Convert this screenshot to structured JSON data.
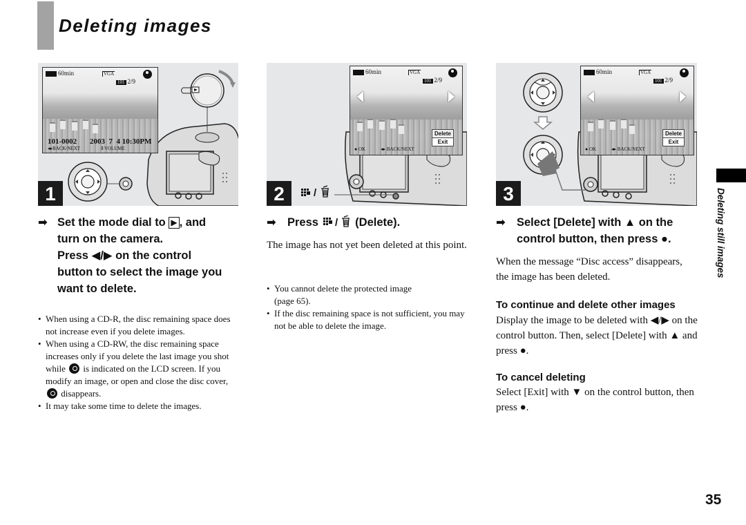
{
  "page": {
    "title": "Deleting images",
    "side_label": "Deleting still images",
    "page_number": "35"
  },
  "lcd": {
    "battery": "60min",
    "quality": "VGA",
    "folder": "101",
    "counter": "2/9",
    "file_number": "101-0002",
    "date_time": "2003  7  4 10:30PM",
    "back_next": "◂▸BACK/NEXT",
    "volume": "⇕VOLUME",
    "ok": "● OK",
    "back_next_2": "◂▸ BACK/NEXT",
    "delete_option": "Delete",
    "exit_option": "Exit"
  },
  "steps": [
    {
      "number": "1",
      "heading_parts": [
        "Set the mode dial to ",
        ", and",
        "turn on the camera.",
        "Press ◀/▶ on the control",
        "button to select the image you",
        "want to delete."
      ],
      "play_symbol": "▶",
      "notes": [
        "When using a CD-R, the disc remaining space does not increase even if you delete images.",
        "When using a CD-RW, the disc remaining space increases only if you delete the last image you shot while",
        "is indicated on the LCD screen. If you modify an image, or open and close the disc cover,",
        "disappears.",
        "It may take some time to delete the images."
      ]
    },
    {
      "number": "2",
      "button_label": "▦ / 🗑",
      "heading": "Press ▦ / 🗑 (Delete).",
      "heading_prefix": "Press",
      "heading_suffix": "(Delete).",
      "body": "The image has not yet been deleted at this point.",
      "notes": [
        "You cannot delete the protected image (page 65).",
        "If the disc remaining space is not sufficient, you may not be able to delete the image."
      ]
    },
    {
      "number": "3",
      "heading_line1": "Select [Delete] with ▲ on the",
      "heading_line2": "control button, then press ●.",
      "body": "When the message “Disc access” disappears, the image has been deleted.",
      "continue_heading": "To continue and delete other images",
      "continue_body": "Display the image to be deleted with ◀/▶ on the control button. Then, select [Delete] with ▲ and press ●.",
      "cancel_heading": "To cancel deleting",
      "cancel_body": "Select [Exit] with ▼ on the control button, then press ●."
    }
  ],
  "icons": {
    "arrow": "➡",
    "step_arrow": "arrow-right-icon",
    "disc_indicator": "cd-rw-disc-icon",
    "index_delete": "index-trash-icon"
  }
}
